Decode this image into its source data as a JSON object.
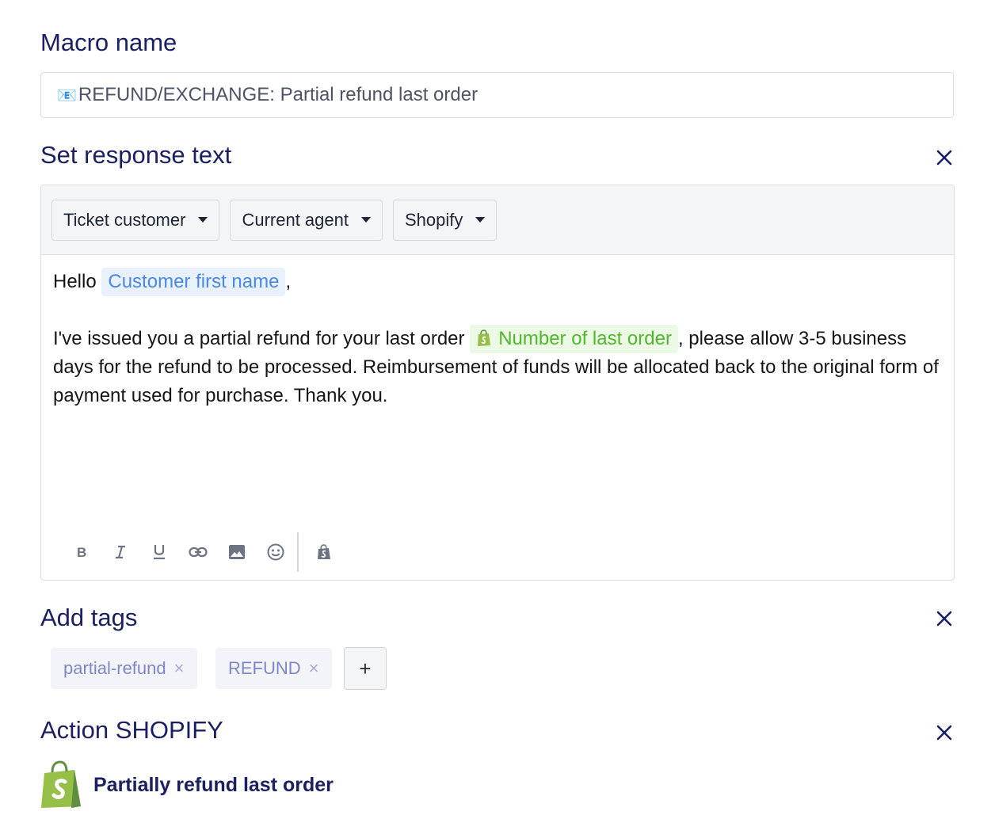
{
  "macro_name": {
    "label": "Macro name",
    "value": "REFUND/EXCHANGE: Partial refund last order",
    "icon": "mail-icon"
  },
  "response_text": {
    "label": "Set response text",
    "toolbar": {
      "dropdowns": [
        "Ticket customer",
        "Current agent",
        "Shopify"
      ]
    },
    "body": {
      "greeting": "Hello",
      "customer_var": "Customer first name",
      "greeting_end": ",",
      "line_start": "I've issued you a partial refund for your last order",
      "order_var": "Number of last order",
      "line_rest": ", please allow 3-5 business days for the refund to be processed. Reimbursement of funds will be allocated back to the original form of payment used for purchase. Thank you."
    },
    "format_buttons": [
      "bold-icon",
      "italic-icon",
      "underline-icon",
      "link-icon",
      "image-icon",
      "emoji-icon",
      "shopify-icon"
    ]
  },
  "tags": {
    "label": "Add tags",
    "items": [
      "partial-refund",
      "REFUND"
    ],
    "add_label": "+"
  },
  "action": {
    "label": "Action SHOPIFY",
    "item_label": "Partially refund last order"
  },
  "colors": {
    "heading": "#1b2061",
    "customer_chip": "#4a89e8",
    "order_chip": "#4fb82c",
    "tag_text": "#8086c8",
    "shopify_green": "#95bf47"
  }
}
